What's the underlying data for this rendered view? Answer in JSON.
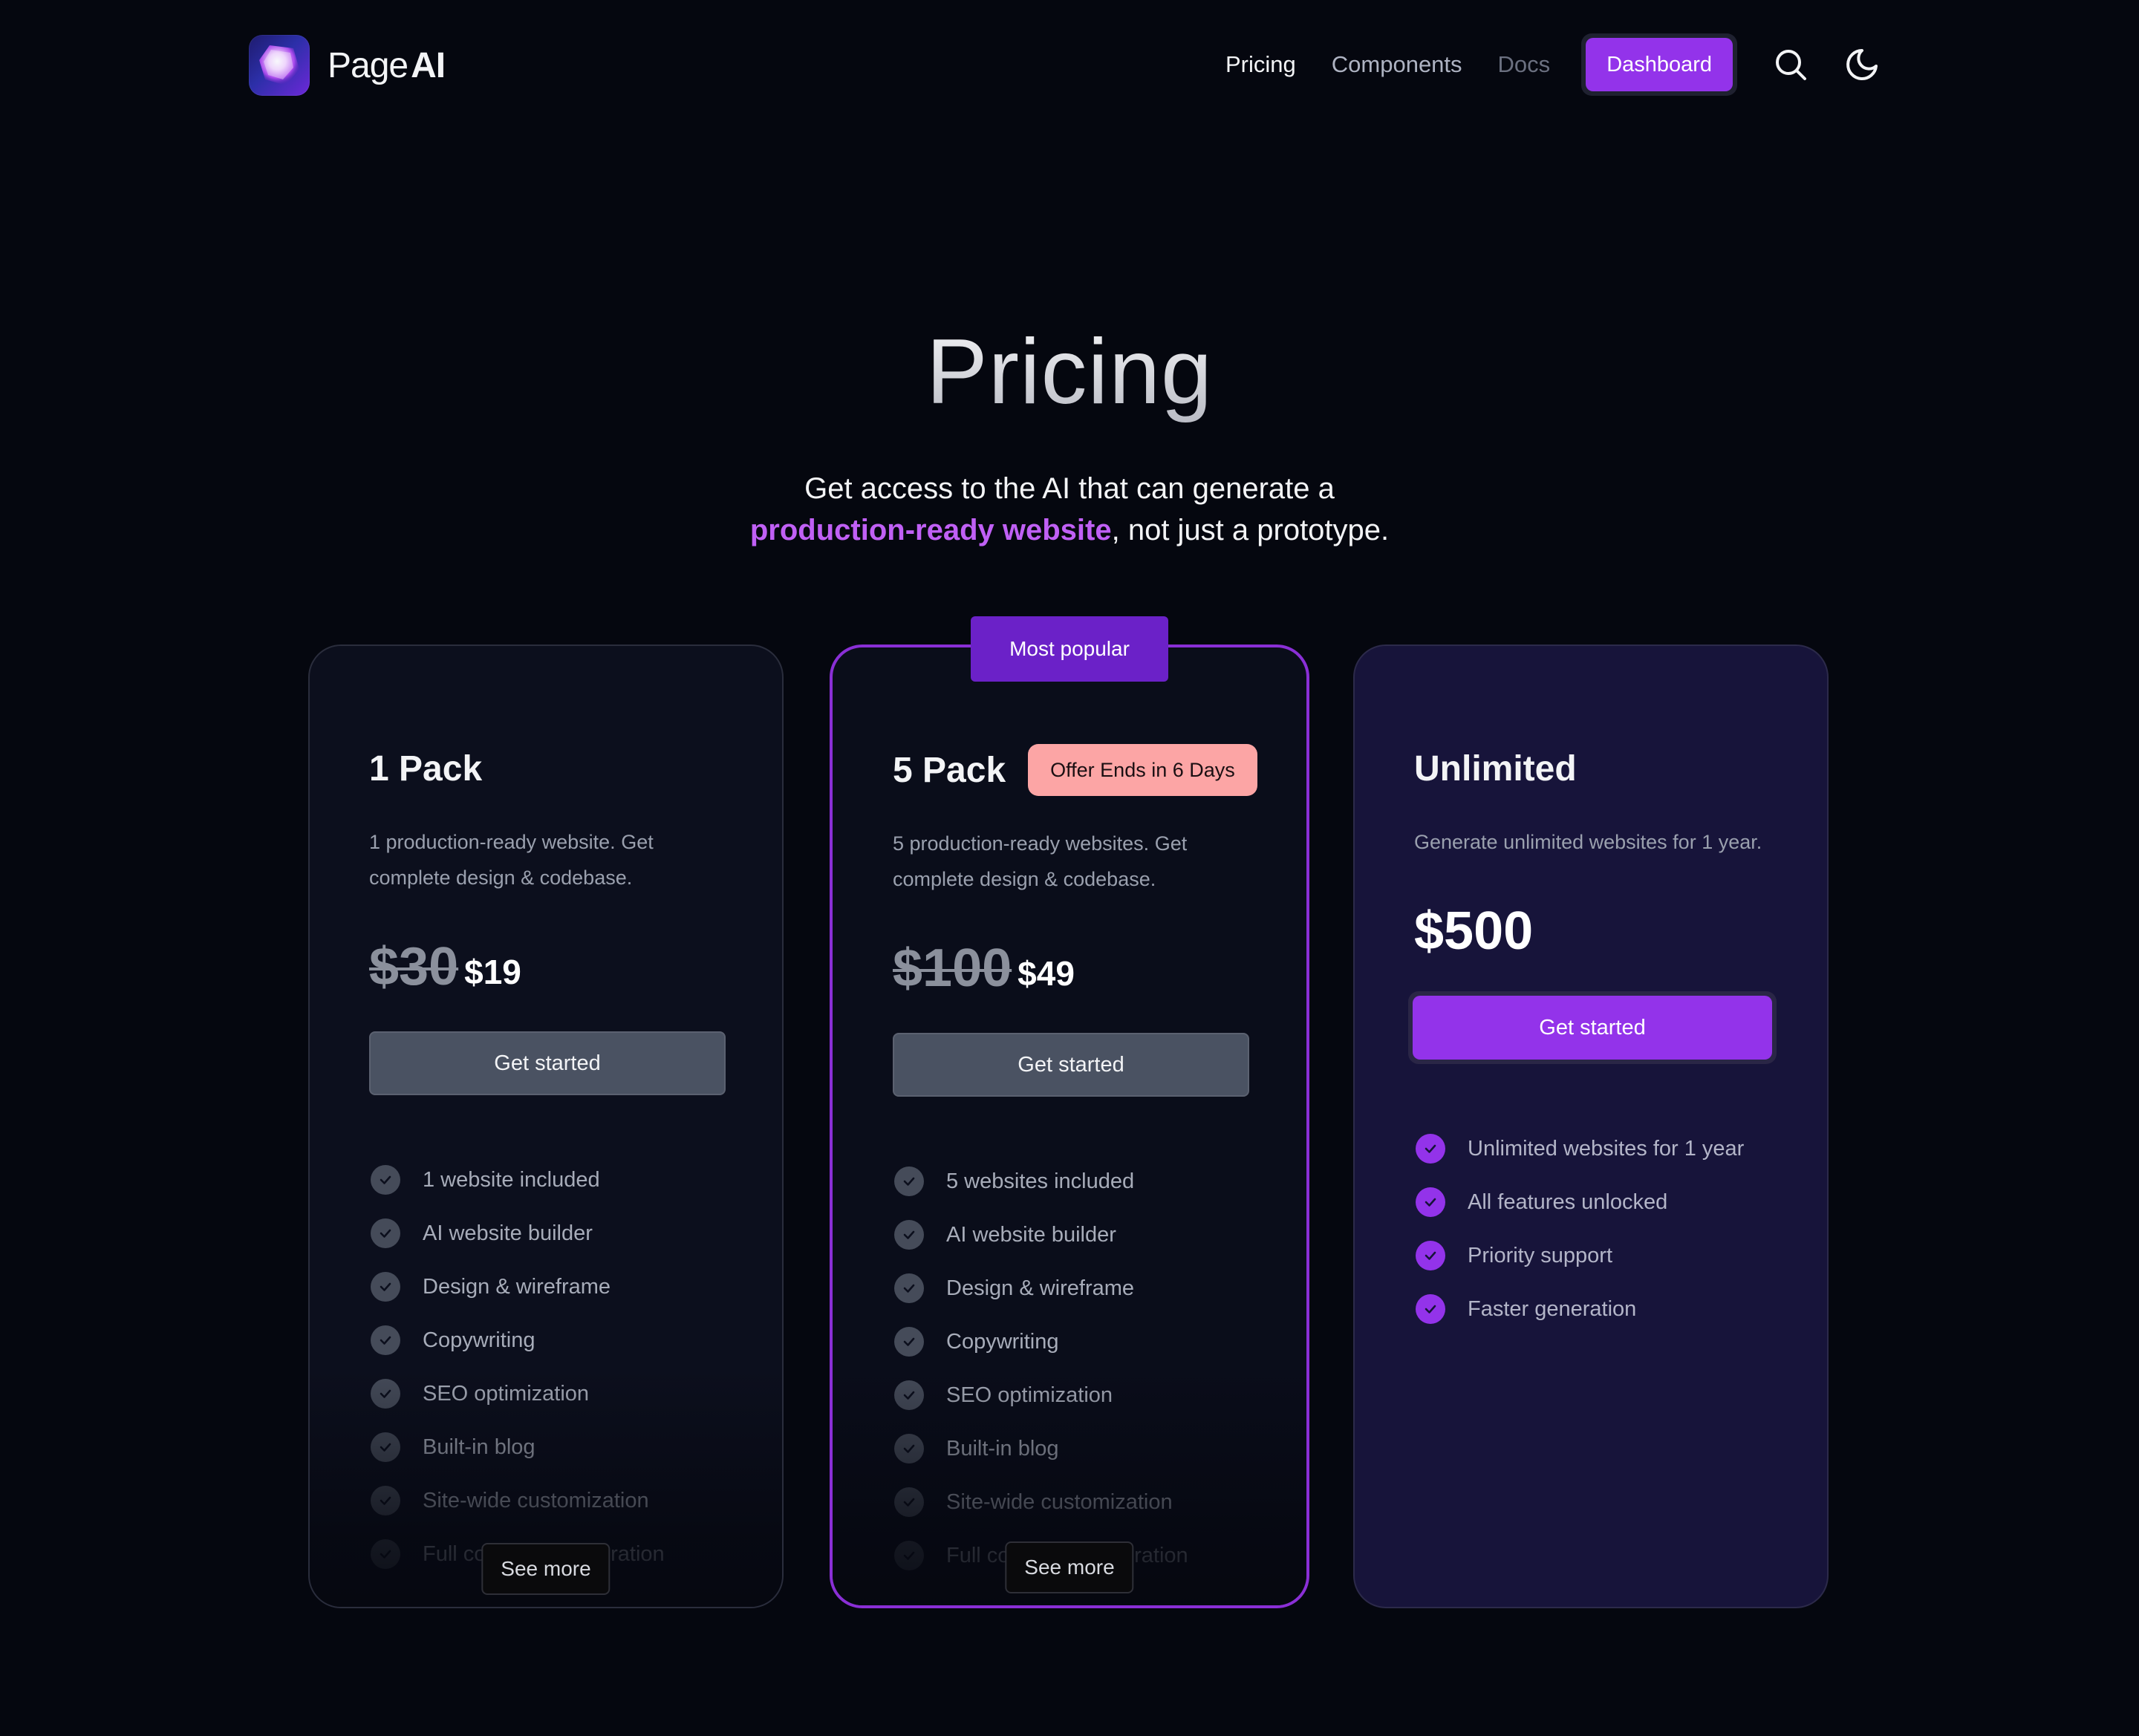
{
  "header": {
    "logo_text_light": "Page",
    "logo_text_bold": "AI",
    "nav": [
      {
        "label": "Pricing"
      },
      {
        "label": "Components"
      },
      {
        "label": "Docs"
      }
    ],
    "dashboard_label": "Dashboard",
    "icons": [
      "search-icon",
      "moon-icon"
    ]
  },
  "hero": {
    "title": "Pricing",
    "subtitle_line1": "Get access to the AI that can generate a",
    "subtitle_highlight": "production-ready website",
    "subtitle_rest": ", not just a prototype."
  },
  "colors": {
    "accent": "#9333ea",
    "offer_badge": "#fca5a5",
    "popular_badge": "#6b21c8",
    "background": "#05070f"
  },
  "plans": [
    {
      "name": "1 Pack",
      "description": "1 production-ready website. Get complete design & codebase.",
      "price_old": "$30",
      "price_new": "$19",
      "cta": "Get started",
      "features": [
        "1 website included",
        "AI website builder",
        "Design & wireframe",
        "Copywriting",
        "SEO optimization",
        "Built-in blog",
        "Site-wide customization",
        "Full codebase generation"
      ],
      "see_more": "See more"
    },
    {
      "name": "5 Pack",
      "badge": "Most popular",
      "offer": "Offer Ends in 6 Days",
      "description": "5 production-ready websites. Get complete design & codebase.",
      "price_old": "$100",
      "price_new": "$49",
      "cta": "Get started",
      "features": [
        "5 websites included",
        "AI website builder",
        "Design & wireframe",
        "Copywriting",
        "SEO optimization",
        "Built-in blog",
        "Site-wide customization",
        "Full codebase generation"
      ],
      "see_more": "See more"
    },
    {
      "name": "Unlimited",
      "description": "Generate unlimited websites for 1 year.",
      "price": "$500",
      "cta": "Get started",
      "features": [
        "Unlimited websites for 1 year",
        "All features unlocked",
        "Priority support",
        "Faster generation"
      ]
    }
  ]
}
